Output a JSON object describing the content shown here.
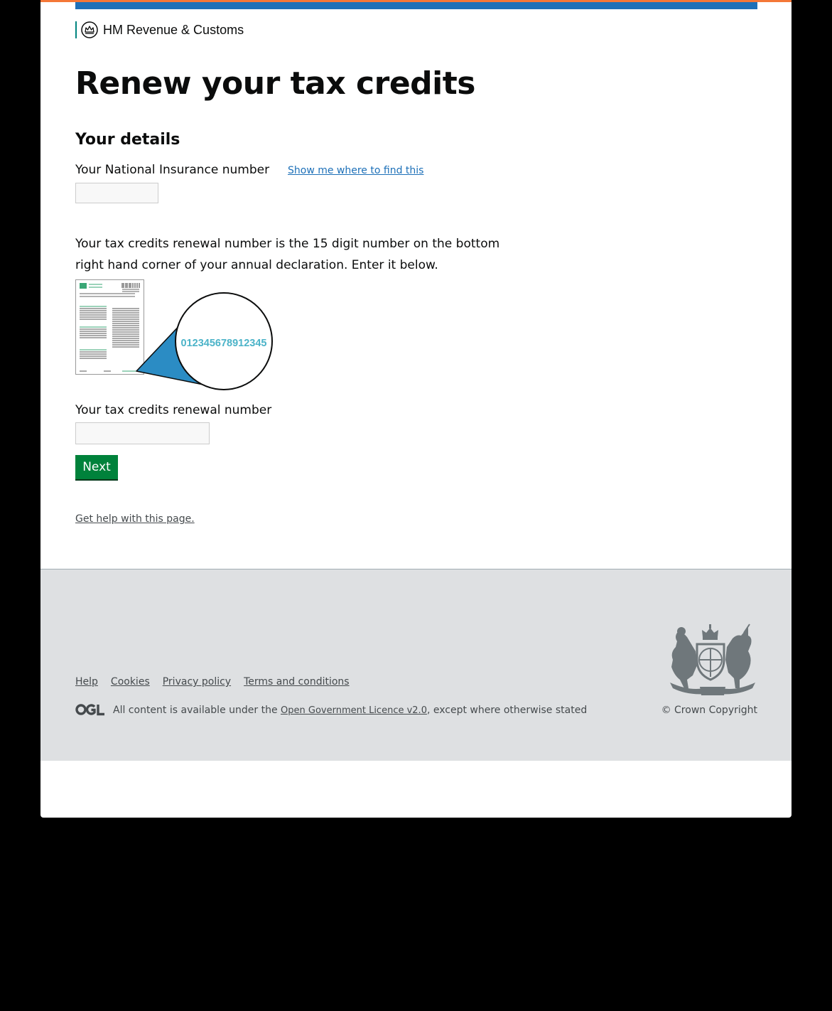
{
  "header": {
    "org_name": "HM Revenue & Customs",
    "crest_icon": "crown-crest-icon"
  },
  "main": {
    "title": "Renew your tax credits",
    "section_heading": "Your details",
    "ni_label": "Your National Insurance number",
    "ni_help_link": "Show me where to find this",
    "ni_value": "",
    "description": "Your tax credits renewal number is the 15 digit number on the bottom right hand corner of your annual declaration. Enter it below.",
    "illustration": {
      "example_number": "012345678912345"
    },
    "renewal_label": "Your tax credits renewal number",
    "renewal_value": "",
    "next_button": "Next",
    "help_link": "Get help with this page."
  },
  "footer": {
    "links": [
      "Help",
      "Cookies",
      "Privacy policy",
      "Terms and conditions"
    ],
    "ogl_icon": "ogl-logo-icon",
    "licence_prefix": "All content is available under the ",
    "licence_link": "Open Government Licence v2.0",
    "licence_suffix": ", except where otherwise stated",
    "copyright": "© Crown Copyright",
    "arms_icon": "royal-coat-of-arms-icon"
  },
  "colors": {
    "top_border": "#f47738",
    "header_bar": "#1d70b8",
    "org_border": "#00847f",
    "button": "#00823b",
    "link": "#1d70b8",
    "footer_bg": "#dee0e2",
    "number_highlight": "#4bb3c8",
    "callout_blue": "#2b8cc4"
  }
}
